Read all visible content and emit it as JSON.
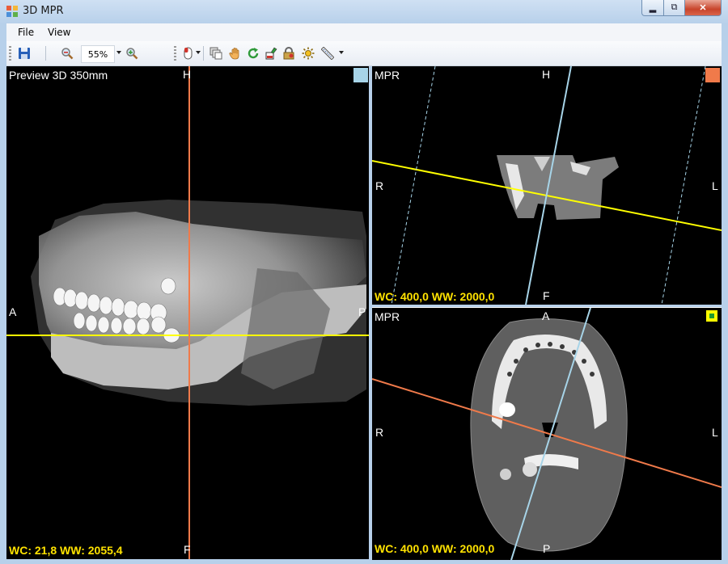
{
  "window": {
    "title": "3D MPR"
  },
  "menu": {
    "file": "File",
    "view": "View"
  },
  "toolbar": {
    "zoom_value": "55%",
    "icons": [
      "save-icon",
      "zoom-out-icon",
      "zoom-in-icon",
      "cursor-mode-icon",
      "copy-layers-icon",
      "hand-pan-icon",
      "rotate-icon",
      "paint-icon",
      "lock-icon",
      "brightness-icon",
      "measure-ruler-icon"
    ]
  },
  "views": {
    "left": {
      "title": "Preview 3D 350mm",
      "top": "H",
      "bottom": "F",
      "left": "A",
      "right": "P",
      "window": "WC: 21,8 WW: 2055,4",
      "marker_color": "#a7d4e8"
    },
    "top_right": {
      "title": "MPR",
      "top": "H",
      "bottom": "F",
      "left": "R",
      "right": "L",
      "window": "WC: 400,0 WW: 2000,0",
      "marker_color": "#f07a4a"
    },
    "bottom_right": {
      "title": "MPR",
      "top": "A",
      "bottom": "P",
      "left": "R",
      "right": "L",
      "window": "WC: 400,0 WW: 2000,0",
      "marker_color": "#ffff00"
    }
  },
  "colors": {
    "axial_line": "#ffff00",
    "sagittal_line": "#f07a4a",
    "coronal_line": "#a7d4e8"
  }
}
